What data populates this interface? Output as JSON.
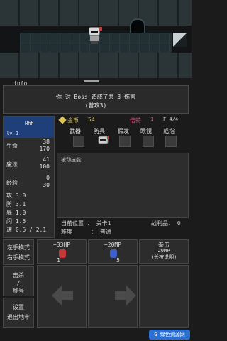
{
  "scene": {
    "hero": "knight-sprite",
    "features": [
      "stone-wall",
      "dark-doorway",
      "stairs-down"
    ]
  },
  "info_tab": "info",
  "log": {
    "line1": "你 对 Boss 造成了共 3 伤害",
    "line2": "(普攻3)"
  },
  "stats": {
    "name": "Hhh",
    "level": "lv 2",
    "hp_label": "生命",
    "hp_cur": "38",
    "hp_max": "170",
    "mp_label": "魔法",
    "mp_cur": "41",
    "mp_max": "100",
    "exp_label": "经验",
    "exp_cur": "0",
    "exp_max": "30",
    "atk": "攻 3.0",
    "def": "防 3.1",
    "crit": "暴 1.0",
    "dodge": "闪 1.5",
    "speed": "速 0.5 / 2.1"
  },
  "topbar": {
    "gold_label": "金币",
    "gold_value": "54",
    "mult_label": "倍特",
    "mult_value": "-1",
    "floor_value": "F 4/4"
  },
  "equipment": {
    "weapon": "武器",
    "armor": "防具",
    "wig": "假发",
    "glasses": "眼镜",
    "ring": "戒指"
  },
  "passive": {
    "title": "被动技能"
  },
  "status": {
    "position_label": "当前位置 ： 关卡1",
    "battle_label": "战利品： 0",
    "difficulty_label": "难度",
    "difficulty_value": "： 普通"
  },
  "controls": {
    "left_mode": "左手模式",
    "right_mode": "右手模式",
    "kill_line1": "击杀",
    "kill_line2": "/",
    "kill_line3": "称号",
    "settings_line1": "设置",
    "settings_line2": "退出地牢",
    "hp_potion_label": "+33HP",
    "hp_potion_count": "1",
    "mp_potion_label": "+20MP",
    "mp_potion_count": "5",
    "skill_title": "拳击",
    "skill_cost": "20MP",
    "skill_hint": "(长按说明)"
  },
  "colors": {
    "gold": "#d9c45a",
    "multiplier": "#d35a8a",
    "stats_header": "#1f3f7a"
  },
  "watermark": "G 绿色资源网"
}
